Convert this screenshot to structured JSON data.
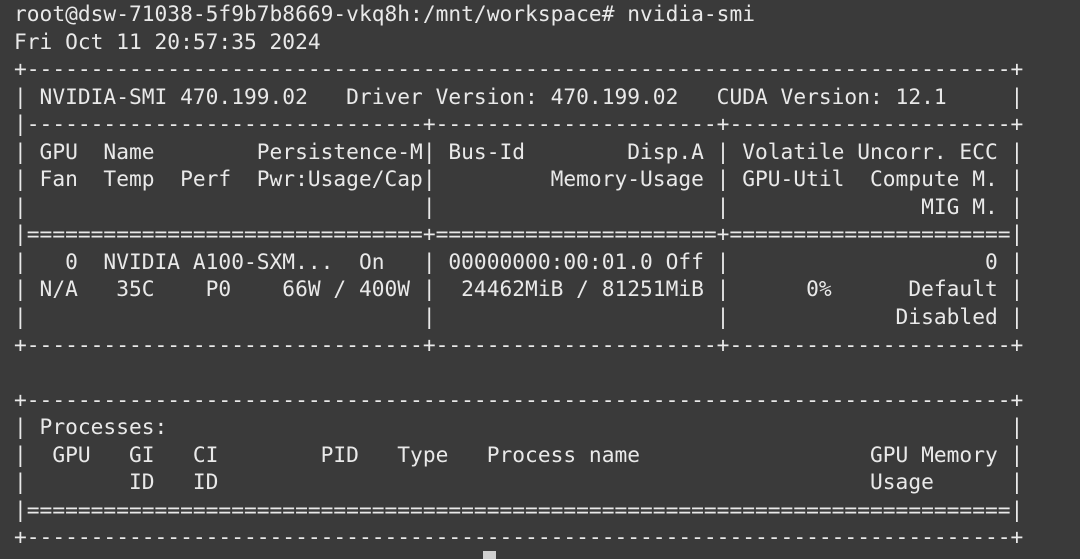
{
  "terminal": {
    "background_color": "#3a3a3a",
    "foreground_color": "#e9e9e9",
    "cursor_color": "#cfcfcf",
    "prompt": {
      "user": "root",
      "host": "dsw-71038-5f9b7b8669-vkq8h",
      "path": "/mnt/workspace",
      "symbol": "#",
      "full": "root@dsw-71038-5f9b7b8669-vkq8h:/mnt/workspace#",
      "command": "nvidia-smi"
    },
    "timestamp": "Fri Oct 11 20:57:35 2024",
    "nvidia_smi": {
      "smi_version_label": "NVIDIA-SMI",
      "smi_version": "470.199.02",
      "driver_version_label": "Driver Version:",
      "driver_version": "470.199.02",
      "cuda_version_label": "CUDA Version:",
      "cuda_version": "12.1",
      "headers": {
        "row1": [
          "GPU",
          "Name",
          "Persistence-M",
          "Bus-Id",
          "Disp.A",
          "Volatile Uncorr. ECC"
        ],
        "row2": [
          "Fan",
          "Temp",
          "Perf",
          "Pwr:Usage/Cap",
          "Memory-Usage",
          "GPU-Util",
          "Compute M."
        ],
        "row3": [
          "MIG M."
        ]
      },
      "gpus": [
        {
          "index": "0",
          "name": "NVIDIA A100-SXM...",
          "persistence_mode": "On",
          "bus_id": "00000000:00:01.0",
          "display_active": "Off",
          "ecc_errors": "0",
          "fan": "N/A",
          "temp": "35C",
          "perf": "P0",
          "power_usage": "66W",
          "power_cap": "400W",
          "power": "66W / 400W",
          "memory_used": "24462MiB",
          "memory_total": "81251MiB",
          "memory": "24462MiB / 81251MiB",
          "gpu_util": "0%",
          "compute_mode": "Default",
          "mig_mode": "Disabled"
        }
      ],
      "processes": {
        "title": "Processes:",
        "headers_row1": [
          "GPU",
          "GI",
          "CI",
          "PID",
          "Type",
          "Process name",
          "GPU Memory"
        ],
        "headers_row2": [
          "ID",
          "ID",
          "Usage"
        ],
        "rows": []
      }
    },
    "lines": [
      "root@dsw-71038-5f9b7b8669-vkq8h:/mnt/workspace# nvidia-smi",
      "Fri Oct 11 20:57:35 2024",
      "+-----------------------------------------------------------------------------+",
      "| NVIDIA-SMI 470.199.02   Driver Version: 470.199.02   CUDA Version: 12.1     |",
      "|-------------------------------+----------------------+----------------------+",
      "| GPU  Name        Persistence-M| Bus-Id        Disp.A | Volatile Uncorr. ECC |",
      "| Fan  Temp  Perf  Pwr:Usage/Cap|         Memory-Usage | GPU-Util  Compute M. |",
      "|                               |                      |               MIG M. |",
      "|===============================+======================+======================|",
      "|   0  NVIDIA A100-SXM...  On   | 00000000:00:01.0 Off |                    0 |",
      "| N/A   35C    P0    66W / 400W |  24462MiB / 81251MiB |      0%      Default |",
      "|                               |                      |             Disabled |",
      "+-------------------------------+----------------------+----------------------+",
      "",
      "+-----------------------------------------------------------------------------+",
      "| Processes:                                                                  |",
      "|  GPU   GI   CI        PID   Type   Process name                  GPU Memory |",
      "|        ID   ID                                                   Usage      |",
      "|=============================================================================|",
      "+-----------------------------------------------------------------------------+"
    ]
  }
}
